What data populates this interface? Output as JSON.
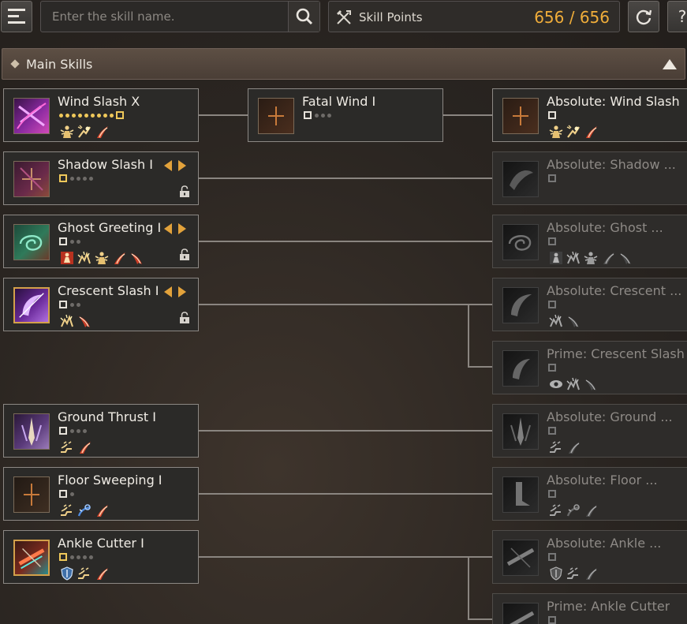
{
  "toolbar": {
    "menu_icon": "menu-icon",
    "search_placeholder": "Enter the skill name.",
    "search_icon": "search-icon",
    "skill_points_icon": "crossed-weapons-icon",
    "skill_points_label": "Skill Points",
    "skill_points_value": "656 / 656",
    "refresh_icon": "refresh-icon",
    "help_label": "?"
  },
  "colors": {
    "accent_gold": "#f0ad3a",
    "card_border": "#8c8884",
    "locked_text": "#8e8a86"
  },
  "section": {
    "title": "Main Skills",
    "collapse_icon": "triangle-up-icon"
  },
  "skills": [
    {
      "name": "Wind Slash X",
      "level_dots": "10 of 10 (max)",
      "badges": [
        "super-armor-icon",
        "knockdown-icon",
        "down-attack-icon"
      ],
      "next": {
        "name": "Fatal Wind I",
        "level_dots": "1 of 4"
      },
      "absolute": {
        "name": "Absolute: Wind Slash",
        "badges": [
          "super-armor-icon",
          "knockdown-icon",
          "down-attack-icon"
        ],
        "unlocked": true
      }
    },
    {
      "name": "Shadow Slash I",
      "level_dots": "1 of 5",
      "badges": [],
      "has_arrows": true,
      "locked_icon": "padlock-icon",
      "absolute": {
        "name": "Absolute: Shadow ...",
        "badges": []
      }
    },
    {
      "name": "Ghost Greeting I",
      "level_dots": "1 of 3",
      "badges": [
        "forward-guard-icon",
        "stiffness-icon",
        "super-armor-icon",
        "down-attack-icon",
        "air-attack-icon"
      ],
      "has_arrows": true,
      "locked_icon": "padlock-icon",
      "absolute": {
        "name": "Absolute: Ghost ...",
        "badges": [
          "forward-guard-icon",
          "stiffness-icon",
          "super-armor-icon",
          "down-attack-icon",
          "air-attack-icon"
        ]
      }
    },
    {
      "name": "Crescent Slash I",
      "level_dots": "1 of 3",
      "badges": [
        "stiffness-icon",
        "air-attack-icon"
      ],
      "has_arrows": true,
      "locked_icon": "padlock-icon",
      "absolute": {
        "name": "Absolute: Crescent ...",
        "badges": [
          "stiffness-icon",
          "air-attack-icon"
        ]
      },
      "prime": {
        "name": "Prime: Crescent Slash",
        "badges": [
          "eye-icon",
          "stiffness-icon",
          "air-attack-icon"
        ]
      }
    },
    {
      "name": "Ground Thrust I",
      "level_dots": "1 of 4",
      "badges": [
        "floating-icon",
        "down-attack-icon"
      ],
      "absolute": {
        "name": "Absolute: Ground ...",
        "badges": [
          "floating-icon",
          "down-attack-icon"
        ]
      }
    },
    {
      "name": "Floor Sweeping I",
      "level_dots": "1 of 2",
      "badges": [
        "floating-icon",
        "grapple-icon",
        "down-attack-icon"
      ],
      "absolute": {
        "name": "Absolute: Floor ...",
        "badges": [
          "floating-icon",
          "grapple-icon",
          "down-attack-icon"
        ]
      }
    },
    {
      "name": "Ankle Cutter I",
      "level_dots": "1 of 5",
      "badges": [
        "shield-icon",
        "floating-icon",
        "down-attack-icon"
      ],
      "absolute": {
        "name": "Absolute: Ankle ...",
        "badges": [
          "shield-icon",
          "floating-icon",
          "down-attack-icon"
        ]
      },
      "prime": {
        "name": "Prime: Ankle Cutter",
        "badges": []
      }
    }
  ]
}
